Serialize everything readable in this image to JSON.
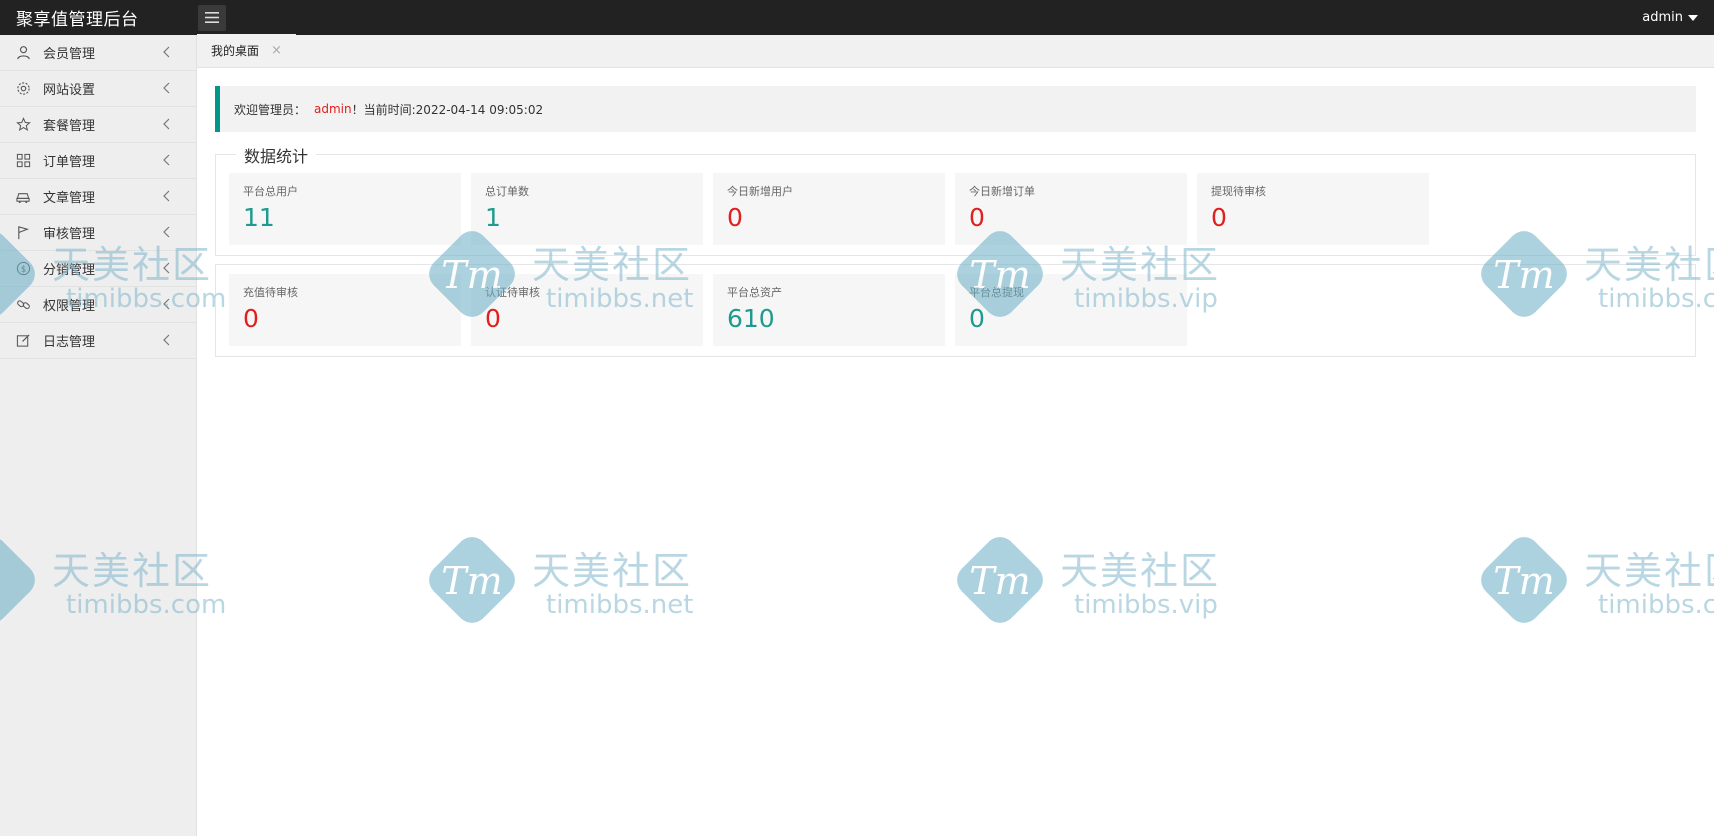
{
  "app": {
    "title": "聚享值管理后台",
    "user": "admin"
  },
  "sidebar": {
    "items": [
      {
        "label": "会员管理",
        "icon": "user-icon"
      },
      {
        "label": "网站设置",
        "icon": "gear-icon"
      },
      {
        "label": "套餐管理",
        "icon": "star-icon"
      },
      {
        "label": "订单管理",
        "icon": "grid-icon"
      },
      {
        "label": "文章管理",
        "icon": "car-icon"
      },
      {
        "label": "审核管理",
        "icon": "flag-icon"
      },
      {
        "label": "分销管理",
        "icon": "dollar-icon"
      },
      {
        "label": "权限管理",
        "icon": "link-icon"
      },
      {
        "label": "日志管理",
        "icon": "edit-icon"
      }
    ]
  },
  "tabs": [
    {
      "label": "我的桌面",
      "close": "×"
    }
  ],
  "welcome": {
    "prefix": "欢迎管理员：",
    "admin": "admin",
    "suffix": "！当前时间:2022-04-14 09:05:02"
  },
  "stats": {
    "legend": "数据统计",
    "row1": [
      {
        "label": "平台总用户",
        "value": "11"
      },
      {
        "label": "总订单数",
        "value": "1"
      },
      {
        "label": "今日新增用户",
        "value": "0"
      },
      {
        "label": "今日新增订单",
        "value": "0"
      },
      {
        "label": "提现待审核",
        "value": "0"
      }
    ],
    "row2": [
      {
        "label": "充值待审核",
        "value": "0"
      },
      {
        "label": "认证待审核",
        "value": "0"
      },
      {
        "label": "平台总资产",
        "value": "610"
      },
      {
        "label": "平台总提现",
        "value": "0"
      }
    ]
  },
  "colors": {
    "header": "#222222",
    "accent": "#009688",
    "green_value": "#1e9a8f",
    "red_value": "#e0201f"
  },
  "watermark": {
    "name": "天美社区",
    "logo_text": "Tm",
    "domains": [
      "timibbs.com",
      "timibbs.net",
      "timibbs.vip"
    ]
  }
}
